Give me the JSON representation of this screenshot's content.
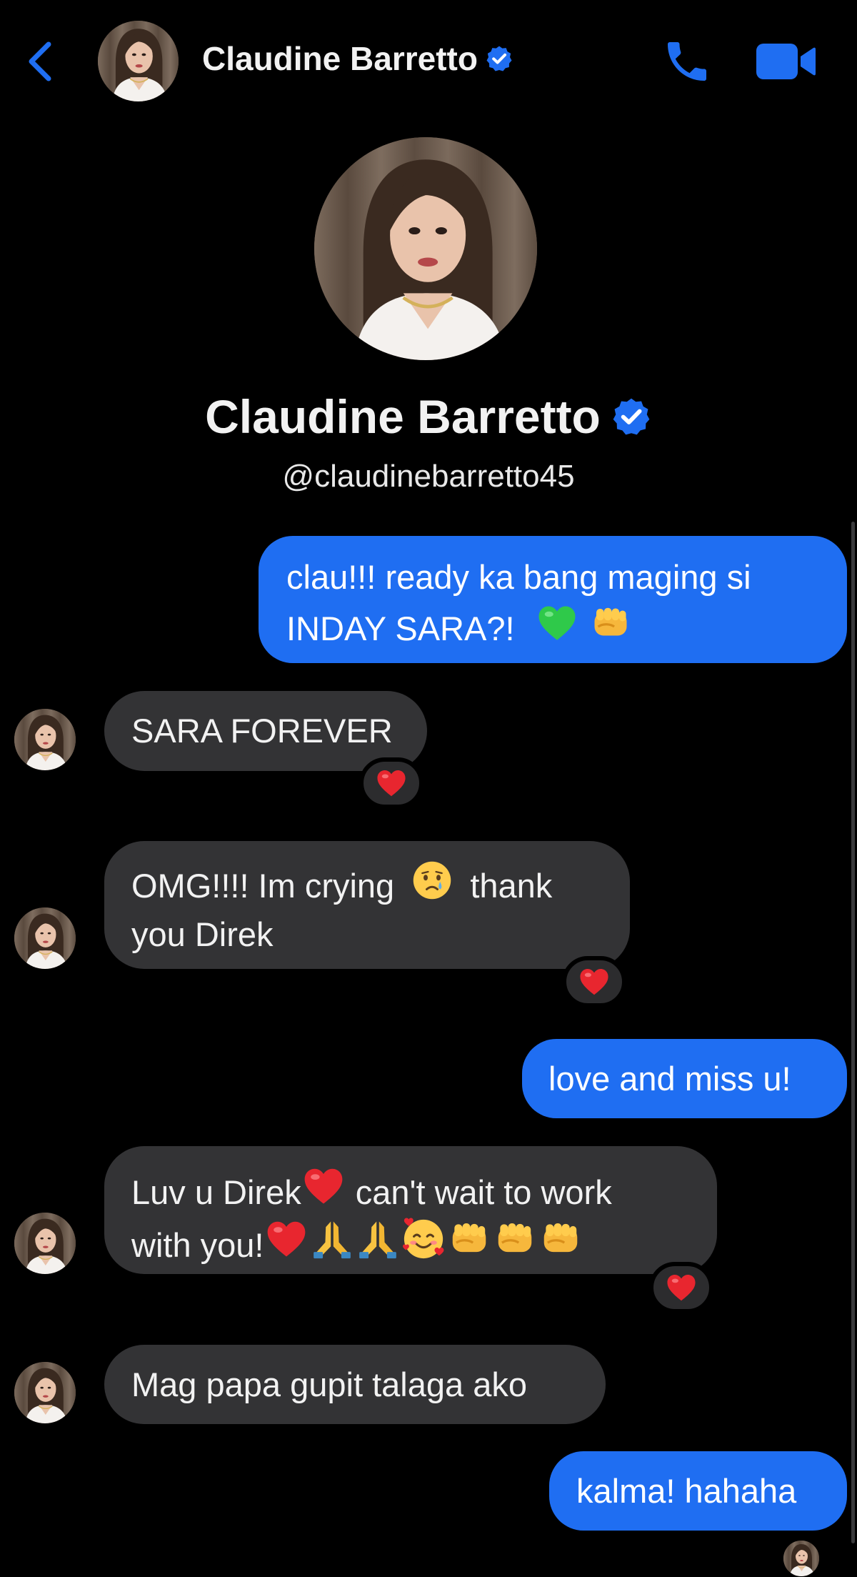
{
  "header": {
    "contact_name": "Claudine Barretto",
    "back_icon": "chevron-left-icon",
    "call_icon": "phone-icon",
    "video_icon": "video-camera-icon"
  },
  "profile": {
    "name": "Claudine Barretto",
    "handle": "@claudinebarretto45",
    "verified_icon": "verified-badge-icon"
  },
  "colors": {
    "accent": "#1f6ef2",
    "incoming_bubble": "#333335",
    "background": "#000000"
  },
  "messages": [
    {
      "id": "m1",
      "direction": "outgoing",
      "line1": "clau!!! ready ka bang maging si",
      "line2": "INDAY SARA?!",
      "emojis": [
        "green-heart",
        "oncoming-fist"
      ]
    },
    {
      "id": "m2",
      "direction": "incoming",
      "text": "SARA FOREVER",
      "reaction": "red-heart"
    },
    {
      "id": "m3",
      "direction": "incoming",
      "line1_a": "OMG!!!! Im crying",
      "line1_b": "thank",
      "line2": "you Direk",
      "emojis": [
        "crying-face"
      ],
      "reaction": "red-heart"
    },
    {
      "id": "m4",
      "direction": "outgoing",
      "text": "love and miss u!"
    },
    {
      "id": "m5",
      "direction": "incoming",
      "line1_a": "Luv u Direk",
      "line1_b": "can't wait to work",
      "line2": "with you!",
      "emojis": [
        "red-heart",
        "red-heart",
        "folded-hands",
        "folded-hands",
        "smiling-face-with-hearts",
        "oncoming-fist",
        "oncoming-fist",
        "oncoming-fist"
      ],
      "reaction": "red-heart"
    },
    {
      "id": "m6",
      "direction": "incoming",
      "text": "Mag papa gupit talaga ako"
    },
    {
      "id": "m7",
      "direction": "outgoing",
      "text": "kalma! hahaha",
      "seen": true
    }
  ]
}
